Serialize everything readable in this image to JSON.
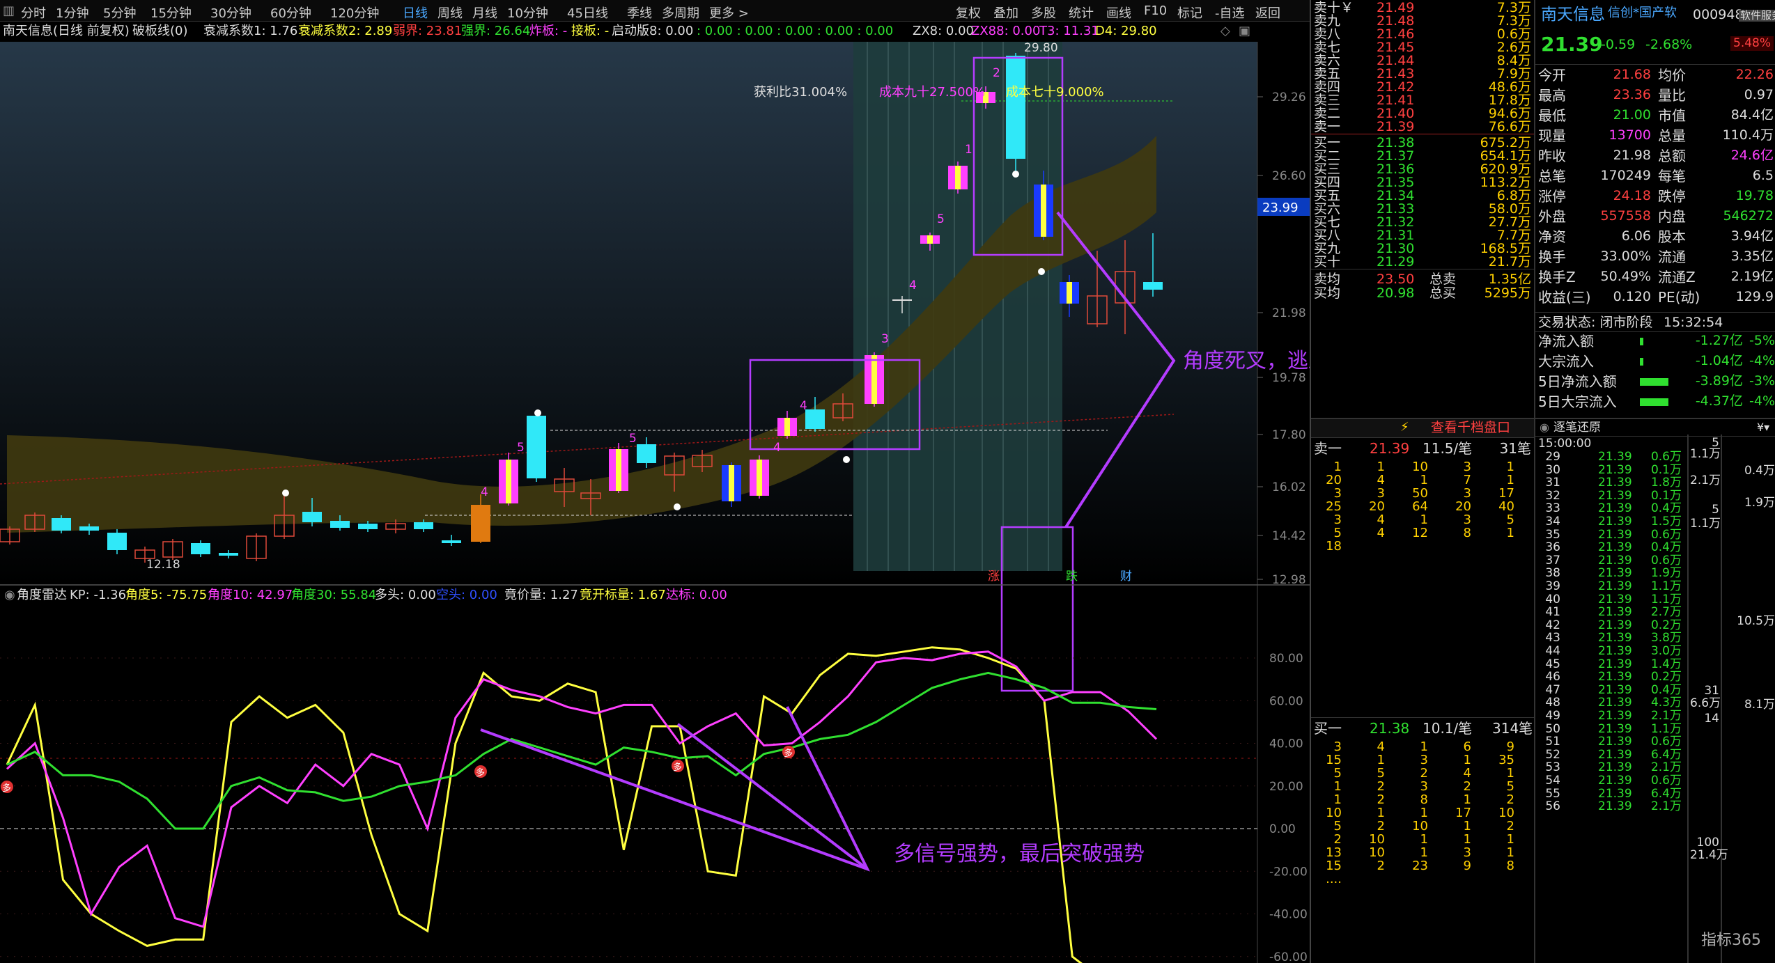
{
  "toolbar": {
    "items": [
      "分时",
      "1分钟",
      "5分钟",
      "15分钟",
      "30分钟",
      "60分钟",
      "120分钟",
      "日线",
      "周线",
      "月线",
      "10分钟",
      "45日线",
      "季线",
      "多周期",
      "更多 >"
    ],
    "active": "日线",
    "right_items": [
      "复权",
      "叠加",
      "多股",
      "统计",
      "画线",
      "F10",
      "标记",
      "-自选",
      "返回"
    ]
  },
  "infobar": {
    "title": "南天信息(日线 前复权)",
    "indicator": "破板线(0)",
    "coef1": "衰减系数1: 1.76",
    "coef2": "衰减系数2: 2.89",
    "weak": "弱界: 23.81",
    "strong": "强界: 26.64",
    "bomb": "炸板: -",
    "catch": "接板: -",
    "start8": "启动版8: 0.00",
    "zeros": ": 0.00  : 0.00  : 0.00  : 0.00  : 0.00",
    "zx8": "ZX8: 0.00",
    "zx88": "ZX88: 0.00",
    "t3": "T3: 11.31",
    "d4": "D4: 29.80"
  },
  "main_chart": {
    "price_axis": [
      "29.26",
      "26.60",
      "23.99",
      "21.98",
      "19.78",
      "17.80",
      "16.02",
      "14.42",
      "12.98"
    ],
    "current_price_tag": "23.99",
    "high_label": "29.80",
    "low_label": "12.18",
    "profit_ratio": "获利比31.004%",
    "cost90": "成本九十27.500%",
    "cost70": "成本七十9.000%",
    "candle_numbers": [
      "4",
      "5",
      "5",
      "4",
      "4",
      "3",
      "4",
      "5",
      "1",
      "2"
    ],
    "event_tags": [
      "涨",
      "跌",
      "财"
    ],
    "annotation_death_cross": "角度死叉，逃跑位置"
  },
  "sub_chart": {
    "header": {
      "name": "角度雷达",
      "kp": "KP: -1.36",
      "a5": "角度5: -75.75",
      "a10": "角度10: 42.97",
      "a30": "角度30: 55.84",
      "long": "多头: 0.00",
      "empty": "空头: 0.00",
      "bid_vol": "竟价量: 1.27",
      "bid_open": "竟开标量: 1.67",
      "target": "达标: 0.00"
    },
    "axis": [
      "80.00",
      "60.00",
      "40.00",
      "20.00",
      "0.00",
      "-20.00",
      "-40.00",
      "-60.00"
    ],
    "marker": "多",
    "annotation_multi_signal": "多信号强势，最后突破强势"
  },
  "chart_data": {
    "type": "line",
    "title": "角度雷达",
    "x": [
      1,
      2,
      3,
      4,
      5,
      6,
      7,
      8,
      9,
      10,
      11,
      12,
      13,
      14,
      15,
      16,
      17,
      18,
      19,
      20,
      21,
      22,
      23,
      24,
      25,
      26,
      27,
      28,
      29,
      30,
      31,
      32,
      33,
      34,
      35,
      36,
      37,
      38,
      39,
      40,
      41,
      42
    ],
    "ylim": [
      -75,
      88
    ],
    "series": [
      {
        "name": "角度5",
        "color": "#ffff40",
        "values": [
          30,
          58,
          -24,
          -40,
          -48,
          -55,
          -52,
          -52,
          50,
          62,
          52,
          58,
          45,
          -3,
          -40,
          -48,
          40,
          73,
          62,
          60,
          68,
          64,
          -10,
          48,
          48,
          -20,
          -22,
          62,
          54,
          72,
          82,
          81,
          83,
          85,
          84,
          80,
          75,
          60,
          -60,
          -70,
          -75,
          -72
        ]
      },
      {
        "name": "角度10",
        "color": "#ff40ff",
        "values": [
          28,
          40,
          5,
          -40,
          -18,
          -8,
          -42,
          -46,
          10,
          20,
          12,
          30,
          20,
          35,
          30,
          0,
          52,
          70,
          65,
          62,
          57,
          54,
          58,
          58,
          40,
          48,
          54,
          39,
          40,
          50,
          62,
          78,
          80,
          79,
          82,
          83,
          76,
          60,
          64,
          64,
          55,
          42
        ]
      },
      {
        "name": "角度30",
        "color": "#30e030",
        "values": [
          30,
          36,
          25,
          25,
          22,
          14,
          0,
          0,
          20,
          24,
          18,
          17,
          13,
          15,
          20,
          22,
          25,
          35,
          42,
          38,
          34,
          30,
          38,
          36,
          33,
          34,
          25,
          35,
          38,
          42,
          44,
          50,
          58,
          66,
          70,
          73,
          70,
          66,
          59,
          59,
          57,
          56
        ]
      }
    ]
  },
  "right_panel": {
    "stock_name": "南天信息",
    "stock_tag": "信创*国产软",
    "stock_code": "000948",
    "service_label": "软件服务",
    "price": "21.39",
    "change": "-0.59",
    "change_pct": "-2.68%",
    "sector_pct": "5.48%",
    "sells": [
      {
        "label": "卖十￥",
        "price": "21.49",
        "vol": "7.3万"
      },
      {
        "label": "卖九",
        "price": "21.48",
        "vol": "7.3万"
      },
      {
        "label": "卖八",
        "price": "21.46",
        "vol": "0.6万"
      },
      {
        "label": "卖七",
        "price": "21.45",
        "vol": "2.6万"
      },
      {
        "label": "卖六",
        "price": "21.44",
        "vol": "8.4万"
      },
      {
        "label": "卖五",
        "price": "21.43",
        "vol": "7.9万"
      },
      {
        "label": "卖四",
        "price": "21.42",
        "vol": "48.6万"
      },
      {
        "label": "卖三",
        "price": "21.41",
        "vol": "17.8万"
      },
      {
        "label": "卖二",
        "price": "21.40",
        "vol": "94.6万"
      },
      {
        "label": "卖一",
        "price": "21.39",
        "vol": "76.6万"
      }
    ],
    "buys": [
      {
        "label": "买一",
        "price": "21.38",
        "vol": "675.2万"
      },
      {
        "label": "买二",
        "price": "21.37",
        "vol": "654.1万"
      },
      {
        "label": "买三",
        "price": "21.36",
        "vol": "620.9万"
      },
      {
        "label": "买四",
        "price": "21.35",
        "vol": "113.2万"
      },
      {
        "label": "买五",
        "price": "21.34",
        "vol": "6.8万"
      },
      {
        "label": "买六",
        "price": "21.33",
        "vol": "58.0万"
      },
      {
        "label": "买七",
        "price": "21.32",
        "vol": "27.7万"
      },
      {
        "label": "买八",
        "price": "21.31",
        "vol": "7.7万"
      },
      {
        "label": "买九",
        "price": "21.30",
        "vol": "168.5万"
      },
      {
        "label": "买十",
        "price": "21.29",
        "vol": "21.7万"
      }
    ],
    "avg_sell": {
      "label": "卖均",
      "price": "23.50",
      "tlabel": "总卖",
      "tval": "1.35亿"
    },
    "avg_buy": {
      "label": "买均",
      "price": "20.98",
      "tlabel": "总买",
      "tval": "5295万"
    },
    "view_depth": "查看千档盘口",
    "sell1_header": {
      "label": "卖一",
      "price": "21.39",
      "per": "11.5/笔",
      "count": "31笔"
    },
    "sell1_queue": [
      [
        "1",
        "1",
        "10",
        "3",
        "1"
      ],
      [
        "20",
        "4",
        "1",
        "7",
        "1"
      ],
      [
        "3",
        "3",
        "50",
        "3",
        "17"
      ],
      [
        "25",
        "20",
        "64",
        "20",
        "40"
      ],
      [
        "3",
        "4",
        "1",
        "3",
        "5"
      ],
      [
        "5",
        "4",
        "12",
        "8",
        "1"
      ],
      [
        "18",
        "",
        "",
        "",
        ""
      ]
    ],
    "buy1_header": {
      "label": "买一",
      "price": "21.38",
      "per": "10.1/笔",
      "count": "314笔"
    },
    "buy1_queue": [
      [
        "3",
        "4",
        "1",
        "6",
        "9"
      ],
      [
        "15",
        "1",
        "3",
        "1",
        "35"
      ],
      [
        "5",
        "5",
        "2",
        "4",
        "1"
      ],
      [
        "1",
        "2",
        "3",
        "2",
        "5"
      ],
      [
        "1",
        "2",
        "8",
        "1",
        "2"
      ],
      [
        "10",
        "1",
        "1",
        "17",
        "10"
      ],
      [
        "5",
        "2",
        "10",
        "1",
        "2"
      ],
      [
        "2",
        "10",
        "1",
        "1",
        "1"
      ],
      [
        "13",
        "10",
        "1",
        "3",
        "1"
      ],
      [
        "15",
        "2",
        "23",
        "9",
        "8"
      ],
      [
        "....",
        "",
        "",
        "",
        ""
      ]
    ],
    "quote": [
      {
        "l1": "今开",
        "v1": "21.68",
        "l2": "均价",
        "v2": "22.26",
        "c1": "#ff4040",
        "c2": "#ff4040"
      },
      {
        "l1": "最高",
        "v1": "23.36",
        "l2": "量比",
        "v2": "0.97",
        "c1": "#ff4040",
        "c2": "#ddd"
      },
      {
        "l1": "最低",
        "v1": "21.00",
        "l2": "市值",
        "v2": "84.4亿",
        "c1": "#30e030",
        "c2": "#ddd"
      },
      {
        "l1": "现量",
        "v1": "13700",
        "l2": "总量",
        "v2": "110.4万",
        "c1": "#ff40ff",
        "c2": "#ddd"
      },
      {
        "l1": "昨收",
        "v1": "21.98",
        "l2": "总额",
        "v2": "24.6亿",
        "c1": "#ddd",
        "c2": "#ff40ff"
      },
      {
        "l1": "总笔",
        "v1": "170249",
        "l2": "每笔",
        "v2": "6.5",
        "c1": "#ddd",
        "c2": "#ddd"
      },
      {
        "l1": "涨停",
        "v1": "24.18",
        "l2": "跌停",
        "v2": "19.78",
        "c1": "#ff4040",
        "c2": "#30e030"
      },
      {
        "l1": "外盘",
        "v1": "557558",
        "l2": "内盘",
        "v2": "546272",
        "c1": "#ff4040",
        "c2": "#30e030"
      },
      {
        "l1": "净资",
        "v1": "6.06",
        "l2": "股本",
        "v2": "3.94亿",
        "c1": "#ddd",
        "c2": "#ddd"
      },
      {
        "l1": "换手",
        "v1": "33.00%",
        "l2": "流通",
        "v2": "3.35亿",
        "c1": "#ddd",
        "c2": "#ddd"
      },
      {
        "l1": "换手Z",
        "v1": "50.49%",
        "l2": "流通Z",
        "v2": "2.19亿",
        "c1": "#ddd",
        "c2": "#ddd"
      },
      {
        "l1": "收益(三)",
        "v1": "0.120",
        "l2": "PE(动)",
        "v2": "129.9",
        "c1": "#ddd",
        "c2": "#ddd"
      }
    ],
    "trade_state_label": "交易状态: 闭市阶段",
    "trade_time": "15:32:54",
    "flows": [
      {
        "label": "净流入额",
        "val": "-1.27亿",
        "pct": "-5%",
        "bar": 0.1
      },
      {
        "label": "大宗流入",
        "val": "-1.04亿",
        "pct": "-4%",
        "bar": 0.1
      },
      {
        "label": "5日净流入额",
        "val": "-3.89亿",
        "pct": "-3%",
        "bar": 0.9
      },
      {
        "label": "5日大宗流入",
        "val": "-4.37亿",
        "pct": "-4%",
        "bar": 0.9
      }
    ],
    "tick_title": "逐笔还原",
    "tick_start_time": "15:00:00",
    "ticks": [
      [
        "29",
        "21.39",
        "0.6万"
      ],
      [
        "30",
        "21.39",
        "0.1万"
      ],
      [
        "31",
        "21.39",
        "1.8万"
      ],
      [
        "32",
        "21.39",
        "0.1万"
      ],
      [
        "33",
        "21.39",
        "0.4万"
      ],
      [
        "34",
        "21.39",
        "1.5万"
      ],
      [
        "35",
        "21.39",
        "0.6万"
      ],
      [
        "36",
        "21.39",
        "0.4万"
      ],
      [
        "37",
        "21.39",
        "0.6万"
      ],
      [
        "38",
        "21.39",
        "1.9万"
      ],
      [
        "39",
        "21.39",
        "1.1万"
      ],
      [
        "40",
        "21.39",
        "1.1万"
      ],
      [
        "41",
        "21.39",
        "2.7万"
      ],
      [
        "42",
        "21.39",
        "0.2万"
      ],
      [
        "43",
        "21.39",
        "3.8万"
      ],
      [
        "44",
        "21.39",
        "3.0万"
      ],
      [
        "45",
        "21.39",
        "1.4万"
      ],
      [
        "46",
        "21.39",
        "0.2万"
      ],
      [
        "47",
        "21.39",
        "0.4万"
      ],
      [
        "48",
        "21.39",
        "4.3万"
      ],
      [
        "49",
        "21.39",
        "2.1万"
      ],
      [
        "50",
        "21.39",
        "1.1万"
      ],
      [
        "51",
        "21.39",
        "0.6万"
      ],
      [
        "52",
        "21.39",
        "6.4万"
      ],
      [
        "53",
        "21.39",
        "2.1万"
      ],
      [
        "54",
        "21.39",
        "0.6万"
      ],
      [
        "55",
        "21.39",
        "6.4万"
      ],
      [
        "56",
        "21.39",
        "2.1万"
      ]
    ],
    "side_vols": [
      "5",
      "1.1万",
      "2.1万",
      "5",
      "1.1万",
      "31",
      "6.6万",
      "14",
      "100",
      "21.4万"
    ],
    "far_vols": [
      "0.4万",
      "1.9万",
      "10.5万",
      "8.1万"
    ],
    "watermark": "指标365"
  }
}
